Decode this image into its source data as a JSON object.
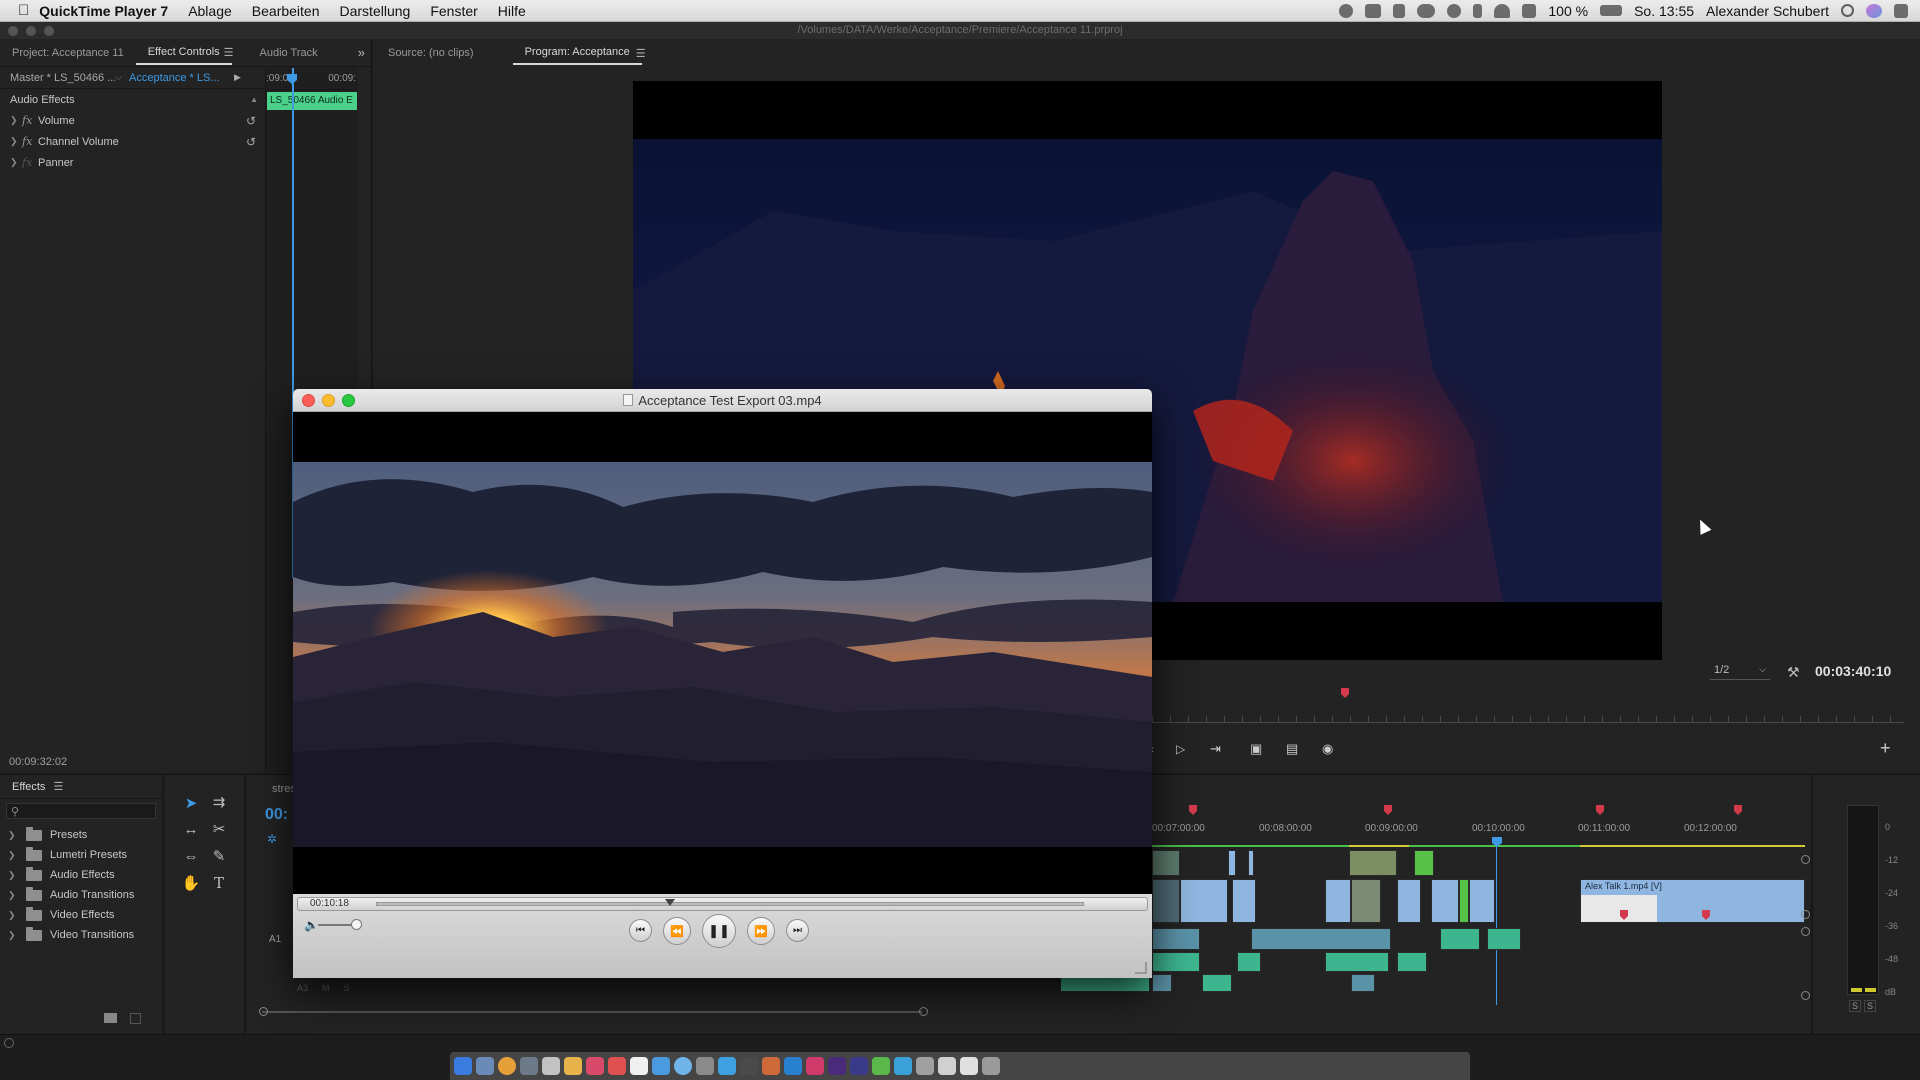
{
  "menubar": {
    "app_name": "QuickTime Player 7",
    "items": [
      "Ablage",
      "Bearbeiten",
      "Darstellung",
      "Fenster",
      "Hilfe"
    ],
    "battery": "100 %",
    "clock": "So. 13:55",
    "user": "Alexander Schubert"
  },
  "window_path": "/Volumes/DATA/Werke/Acceptance/Premiere/Acceptance 11.prproj",
  "top_panel": {
    "tabs": [
      "Project: Acceptance 11",
      "Effect Controls",
      "Audio Track"
    ],
    "active_tab": "Effect Controls",
    "overflow_icon": "double-chevron-right-icon"
  },
  "effect_controls": {
    "master_label": "Master * LS_50466 ...",
    "sequence_label": "Acceptance * LS...",
    "mini_ruler": [
      ":09:00",
      "00:09:"
    ],
    "clip_label": "LS_50466 Audio E",
    "section": "Audio Effects",
    "effects": [
      "Volume",
      "Channel Volume",
      "Panner"
    ],
    "timecode": "00:09:32:02"
  },
  "source_monitor": {
    "label": "Source: (no clips)"
  },
  "program_monitor": {
    "label": "Program: Acceptance",
    "resolution": "1/2",
    "timecode": "00:03:40:10"
  },
  "effects_panel": {
    "title": "Effects",
    "folders": [
      "Presets",
      "Lumetri Presets",
      "Audio Effects",
      "Audio Transitions",
      "Video Effects",
      "Video Transitions"
    ]
  },
  "timeline": {
    "tab_label_partial": "stres",
    "timecode_partial": "00:",
    "ruler": [
      "00:07:00:00",
      "00:08:00:00",
      "00:09:00:00",
      "00:10:00:00",
      "00:11:00:00",
      "00:12:00:00"
    ],
    "track_label": "A1",
    "clip_title": "Alex Talk 1.mp4 [V]",
    "track_sub_labels": [
      "A3",
      "M",
      "S"
    ]
  },
  "meters": {
    "scale": [
      "0",
      "-12",
      "-24",
      "-36",
      "-48",
      "dB"
    ],
    "solo_buttons": [
      "S",
      "S"
    ]
  },
  "quicktime": {
    "title": "Acceptance Test Export 03.mp4",
    "timecode": "00:10:18",
    "buttons": [
      "skip-back",
      "rewind",
      "pause",
      "fast-forward",
      "skip-forward"
    ]
  },
  "colors": {
    "accent_blue": "#3e9ae6",
    "clip_video": "#8fb6e0",
    "clip_audio": "#3db58f",
    "clip_green": "#57c247",
    "marker_red": "#d23a4c",
    "label_green": "#4bd08a"
  }
}
